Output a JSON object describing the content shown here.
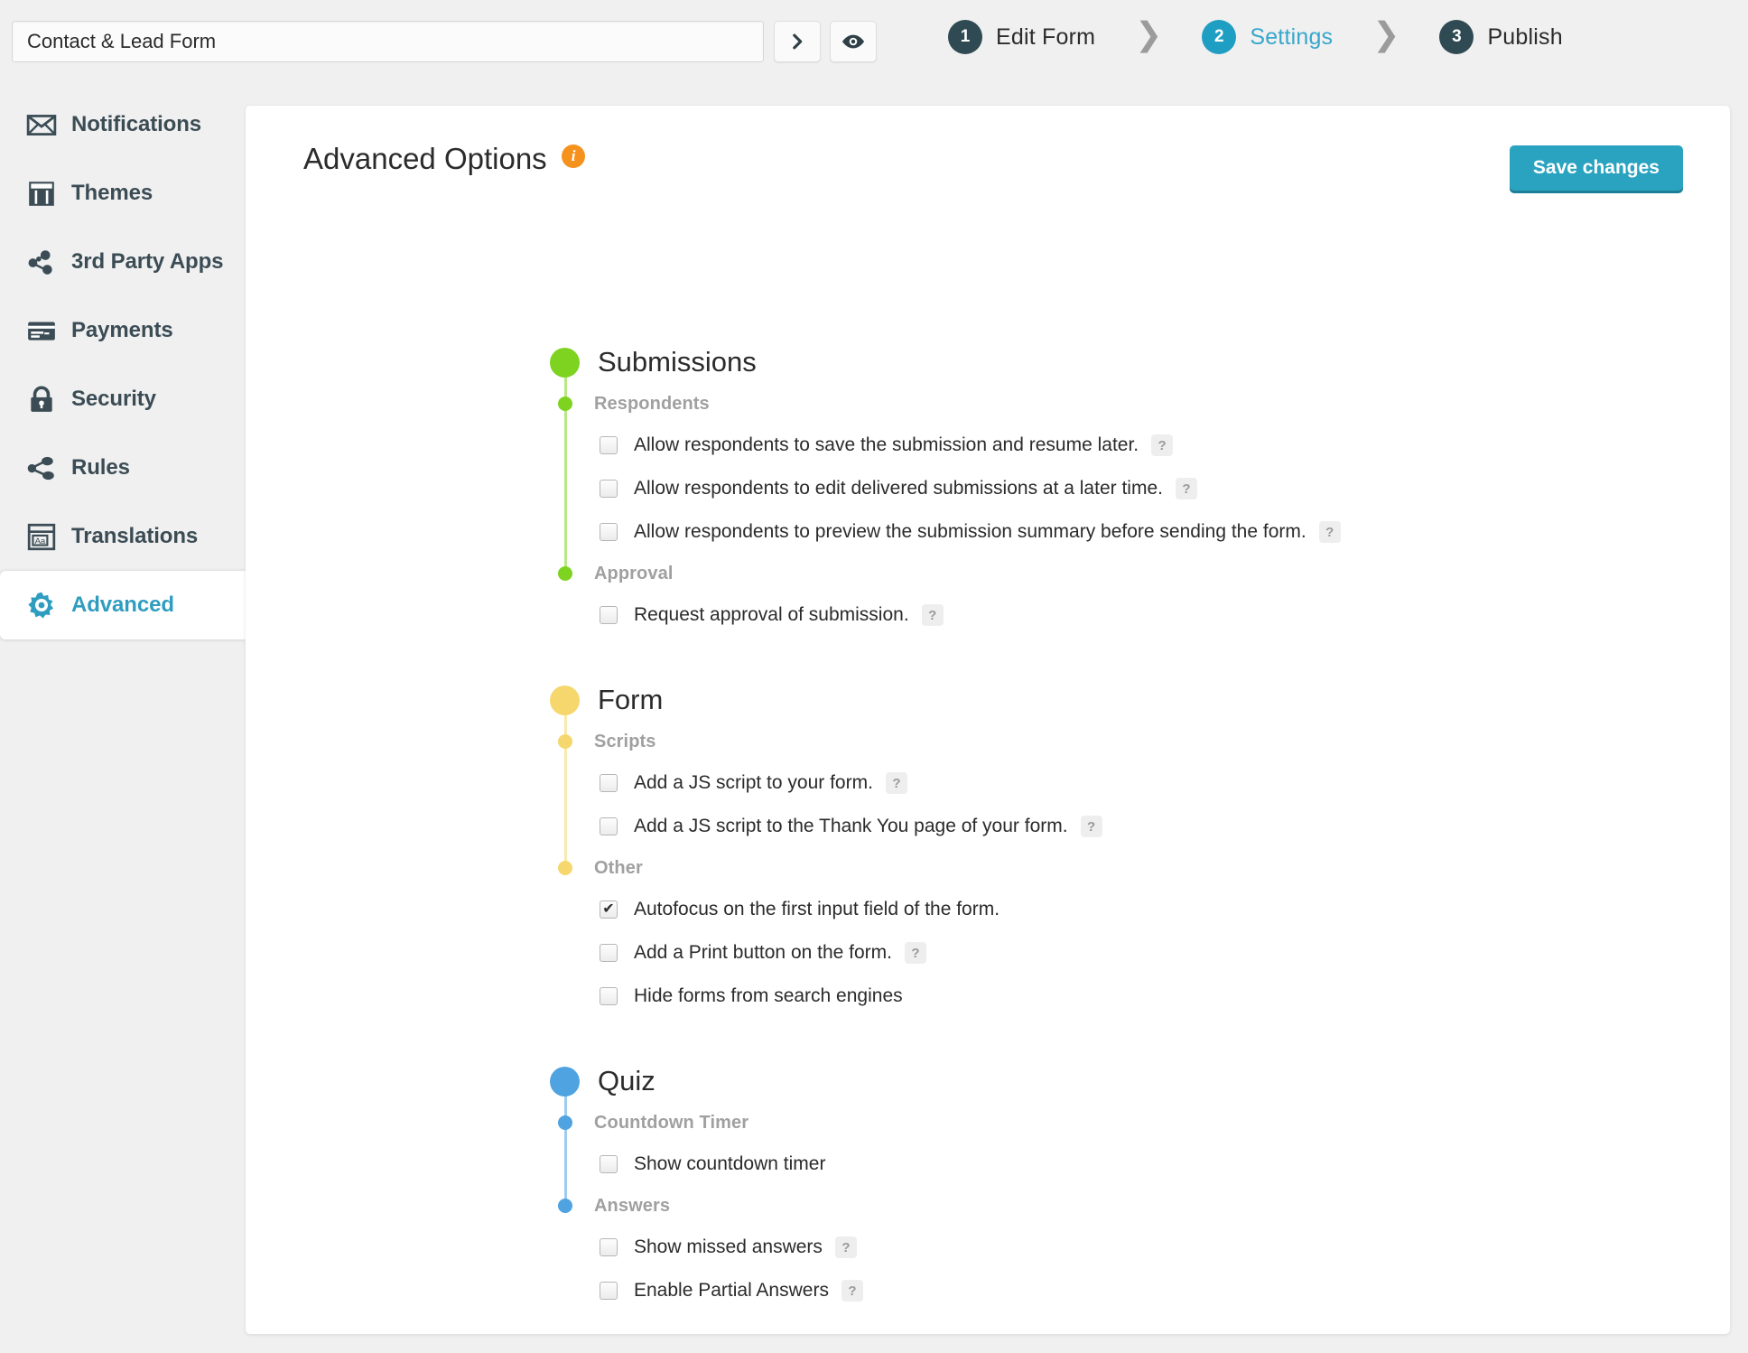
{
  "topbar": {
    "form_title_value": "Contact & Lead Form",
    "form_title_placeholder": "Form name",
    "next_button_label": "›",
    "preview_button_label": "eye",
    "steps": [
      {
        "number": "1",
        "label": "Edit Form",
        "active": false
      },
      {
        "number": "2",
        "label": "Settings",
        "active": true
      },
      {
        "number": "3",
        "label": "Publish",
        "active": false
      }
    ],
    "step_separator": "❯"
  },
  "sidebar": {
    "items": [
      {
        "label": "Notifications",
        "icon": "envelope-icon",
        "active": false
      },
      {
        "label": "Themes",
        "icon": "layout-icon",
        "active": false
      },
      {
        "label": "3rd Party Apps",
        "icon": "apps-nodes-icon",
        "active": false
      },
      {
        "label": "Payments",
        "icon": "credit-card-icon",
        "active": false
      },
      {
        "label": "Security",
        "icon": "lock-icon",
        "active": false
      },
      {
        "label": "Rules",
        "icon": "share-nodes-icon",
        "active": false
      },
      {
        "label": "Translations",
        "icon": "translations-aa-icon",
        "active": false
      },
      {
        "label": "Advanced",
        "icon": "gear-icon",
        "active": true
      }
    ]
  },
  "main": {
    "page_title": "Advanced Options",
    "info_badge": "i",
    "save_button": "Save changes",
    "colors": {
      "submissions": "#7ed321",
      "form": "#f5d76e",
      "quiz": "#4ea3e0",
      "accent": "#2aa3c0",
      "active_nav": "#2f9dc0",
      "info": "#f5921e"
    },
    "sections": [
      {
        "title": "Submissions",
        "color": "#7ed321",
        "groups": [
          {
            "title": "Respondents",
            "options": [
              {
                "label": "Allow respondents to save the submission and resume later.",
                "checked": false,
                "help": true
              },
              {
                "label": "Allow respondents to edit delivered submissions at a later time.",
                "checked": false,
                "help": true
              },
              {
                "label": "Allow respondents to preview the submission summary before sending the form.",
                "checked": false,
                "help": true
              }
            ]
          },
          {
            "title": "Approval",
            "options": [
              {
                "label": "Request approval of submission.",
                "checked": false,
                "help": true
              }
            ]
          }
        ]
      },
      {
        "title": "Form",
        "color": "#f5d76e",
        "groups": [
          {
            "title": "Scripts",
            "options": [
              {
                "label": "Add a JS script to your form.",
                "checked": false,
                "help": true
              },
              {
                "label": "Add a JS script to the Thank You page of your form.",
                "checked": false,
                "help": true
              }
            ]
          },
          {
            "title": "Other",
            "options": [
              {
                "label": "Autofocus on the first input field of the form.",
                "checked": true,
                "help": false
              },
              {
                "label": "Add a Print button on the form.",
                "checked": false,
                "help": true
              },
              {
                "label": "Hide forms from search engines",
                "checked": false,
                "help": false
              }
            ]
          }
        ]
      },
      {
        "title": "Quiz",
        "color": "#4ea3e0",
        "groups": [
          {
            "title": "Countdown Timer",
            "options": [
              {
                "label": "Show countdown timer",
                "checked": false,
                "help": false
              }
            ]
          },
          {
            "title": "Answers",
            "options": [
              {
                "label": "Show missed answers",
                "checked": false,
                "help": true
              },
              {
                "label": "Enable Partial Answers",
                "checked": false,
                "help": true
              }
            ]
          }
        ]
      }
    ],
    "help_glyph": "?"
  }
}
